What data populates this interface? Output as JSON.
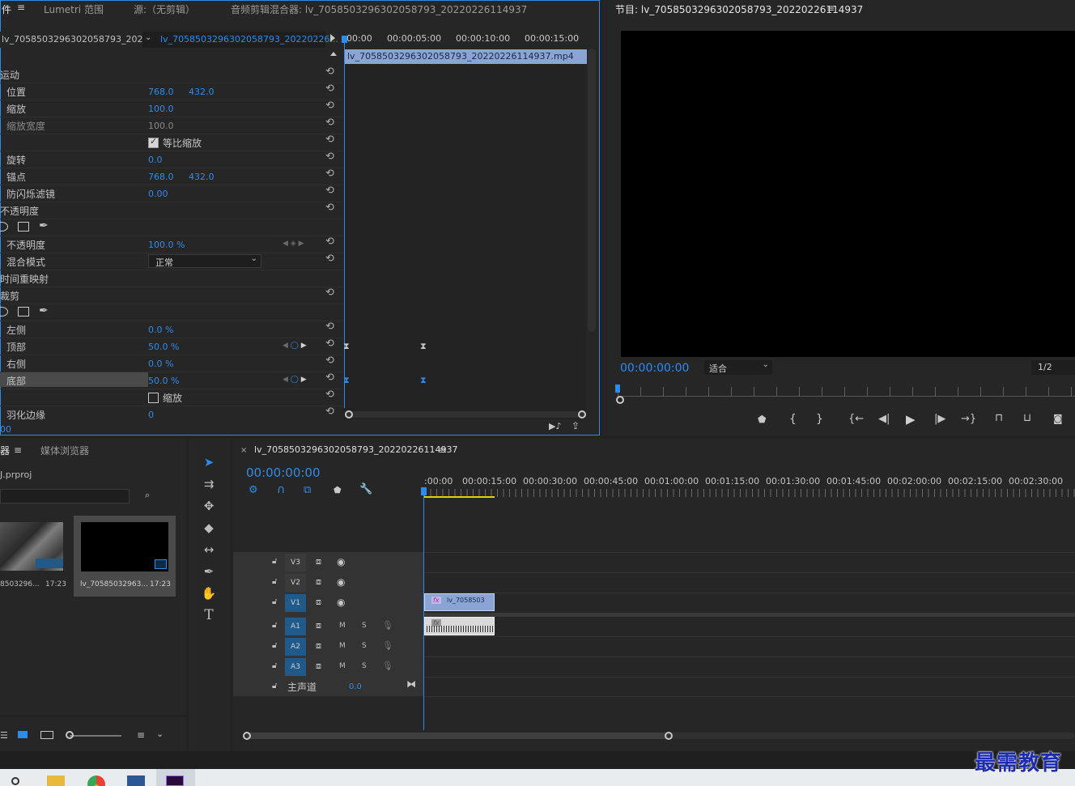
{
  "effect_controls": {
    "tabs": [
      "件",
      "Lumetri 范围",
      "源:（无剪辑）",
      "音频剪辑混合器: lv_7058503296302058793_20220226114937"
    ],
    "source_dropdown": "lv_7058503296302058793_2022...",
    "sequence_dropdown": "lv_7058503296302058793_20220226...",
    "ruler_times": [
      "00:00",
      "00:00:05:00",
      "00:00:10:00",
      "00:00:15:00"
    ],
    "clip_name": "lv_7058503296302058793_20220226114937.mp4",
    "rows": {
      "motion": "运动",
      "position": "位置",
      "position_x": "768.0",
      "position_y": "432.0",
      "scale": "缩放",
      "scale_val": "100.0",
      "scale_width": "缩放宽度",
      "scale_width_val": "100.0",
      "uniform_scale": "等比缩放",
      "rotation": "旋转",
      "rotation_val": "0.0",
      "anchor": "锚点",
      "anchor_x": "768.0",
      "anchor_y": "432.0",
      "antiflicker": "防闪烁滤镜",
      "antiflicker_val": "0.00",
      "opacity_section": "不透明度",
      "opacity": "不透明度",
      "opacity_val": "100.0 %",
      "blend_mode": "混合模式",
      "blend_mode_val": "正常",
      "time_remap": "时间重映射",
      "crop": "裁剪",
      "left": "左侧",
      "left_val": "0.0 %",
      "top": "顶部",
      "top_val": "50.0 %",
      "right": "右侧",
      "right_val": "0.0 %",
      "bottom": "底部",
      "bottom_val": "50.0 %",
      "zoom": "缩放",
      "feather": "羽化边缘",
      "feather_val": "0"
    },
    "bottom_time": "00"
  },
  "program_monitor": {
    "title": "节目: lv_7058503296302058793_20220226114937",
    "timecode": "00:00:00:00",
    "fit": "适合",
    "resolution": "1/2"
  },
  "project_panel": {
    "tabs": [
      "器",
      "媒体浏览器"
    ],
    "project_file": "J.prproj",
    "items": [
      {
        "name": "8503296...",
        "duration": "17:23"
      },
      {
        "name": "lv_70585032963...",
        "duration": "17:23"
      }
    ]
  },
  "timeline": {
    "title": "lv_7058503296302058793_20220226114937",
    "timecode": "00:00:00:00",
    "ruler": [
      ":00:00",
      "00:00:15:00",
      "00:00:30:00",
      "00:00:45:00",
      "00:01:00:00",
      "00:01:15:00",
      "00:01:30:00",
      "00:01:45:00",
      "00:02:00:00",
      "00:02:15:00",
      "00:02:30:00"
    ],
    "video_tracks": [
      "V3",
      "V2",
      "V1"
    ],
    "audio_tracks": [
      "A1",
      "A2",
      "A3"
    ],
    "mute": "M",
    "solo": "S",
    "master": "主声道",
    "master_val": "0.0",
    "clip_label": "lv_7058503",
    "fx": "fx"
  },
  "watermark": "最需教育",
  "colors": {
    "accent": "#2d8ceb",
    "panel": "#262626",
    "track_active": "#1f5a8a",
    "clip_video": "#8aa4d6",
    "playhead": "#2d8ceb",
    "work_area": "#e6d200"
  }
}
